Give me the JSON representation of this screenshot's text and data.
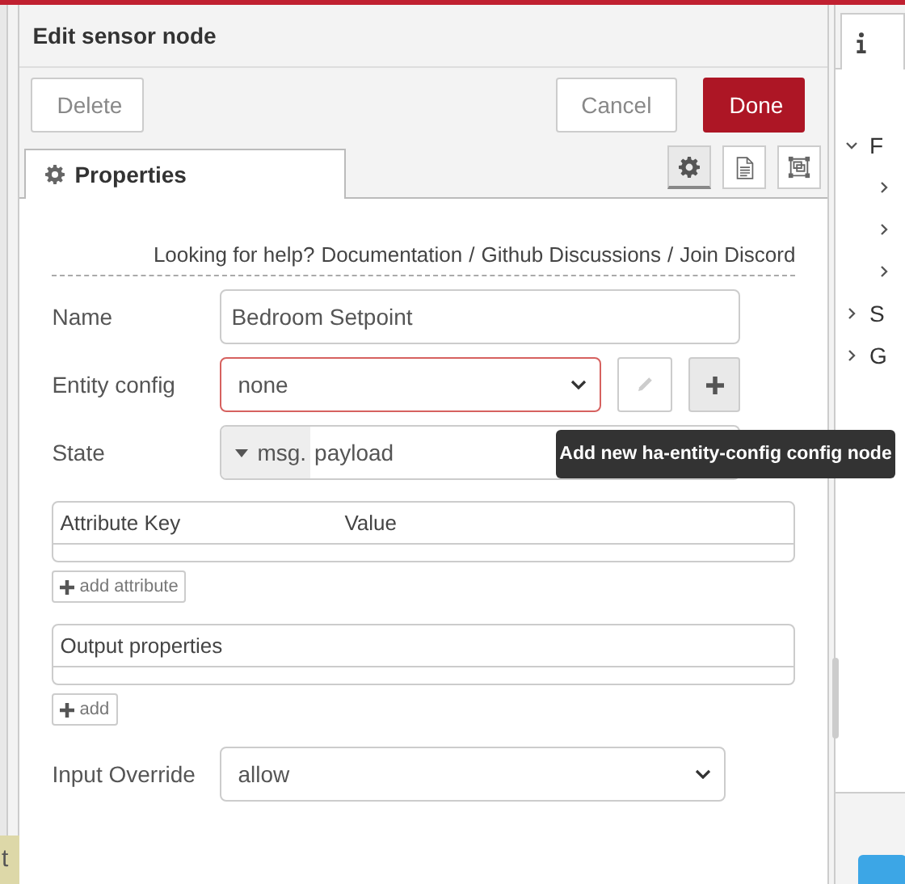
{
  "canvas": {
    "node_label": "t"
  },
  "dialog": {
    "title": "Edit sensor node",
    "buttons": [
      {
        "label": "Delete",
        "kind": "secondary"
      },
      {
        "label": "Cancel",
        "kind": "secondary"
      },
      {
        "label": "Done",
        "kind": "primary"
      }
    ],
    "tabs": [
      {
        "label": "Properties",
        "selected": true
      }
    ],
    "tab_icons": [
      {
        "kind": "gear",
        "selected": true
      },
      {
        "kind": "document",
        "selected": false
      },
      {
        "kind": "frame",
        "selected": false
      }
    ],
    "help": {
      "prefix": "Looking for help?",
      "links": [
        "Documentation",
        "Github Discussions",
        "Join Discord"
      ],
      "separators": [
        "/",
        "/"
      ]
    },
    "fields": [
      {
        "kind": "text",
        "label": "Name",
        "value": "Bedroom Setpoint"
      },
      {
        "kind": "config",
        "label": "Entity config",
        "value": "none",
        "invalid": true,
        "edit_disabled": true
      },
      {
        "kind": "typed",
        "label": "State",
        "type_prefix": "msg.",
        "value": "payload"
      }
    ],
    "tooltip": "Add new ha-entity-config config node",
    "attributes": {
      "columns": [
        "Attribute Key",
        "Value"
      ],
      "add_label": "add attribute"
    },
    "output": {
      "title": "Output properties",
      "add_label": "add"
    },
    "input_override": {
      "label": "Input Override",
      "value": "allow"
    }
  },
  "sidebar": {
    "tree": [
      {
        "label": "F",
        "expanded": true,
        "children": [
          {
            "expanded": false
          },
          {
            "expanded": false
          },
          {
            "expanded": false
          }
        ]
      },
      {
        "label": "S",
        "expanded": false
      },
      {
        "label": "G",
        "expanded": false
      }
    ]
  }
}
